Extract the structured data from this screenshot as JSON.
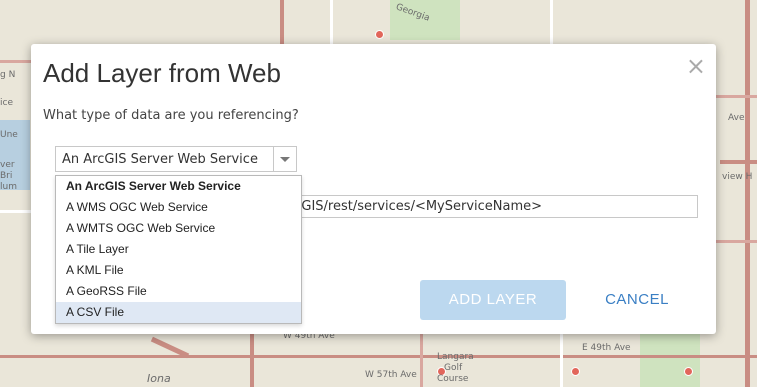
{
  "map": {
    "labels": {
      "georgia": "Georgia",
      "ave_right": "Ave",
      "view_h": "view H",
      "w49": "W 49th Ave",
      "e49": "E 49th Ave",
      "langara": "Langara",
      "golf": "Golf",
      "course": "Course",
      "w57": "W 57th Ave",
      "iona": "Iona",
      "left1": "ice",
      "left2": "Une",
      "left3": "ver",
      "left4": "Bri",
      "left5": "lum",
      "left6": "g N"
    }
  },
  "dialog": {
    "title": "Add Layer from Web",
    "close_symbol": "×",
    "question": "What type of data are you referencing?",
    "select": {
      "value": "An ArcGIS Server Web Service",
      "options": [
        "An ArcGIS Server Web Service",
        "A WMS OGC Web Service",
        "A WMTS OGC Web Service",
        "A Tile Layer",
        "A KML File",
        "A GeoRSS File",
        "A CSV File"
      ]
    },
    "url_visible_text": ":GIS/rest/services/<MyServiceName>",
    "add_button": "ADD LAYER",
    "cancel_button": "CANCEL"
  },
  "colors": {
    "accent": "#3a7fc4",
    "button_disabled": "#bcd8ef",
    "hover_row": "#dfe8f4"
  }
}
